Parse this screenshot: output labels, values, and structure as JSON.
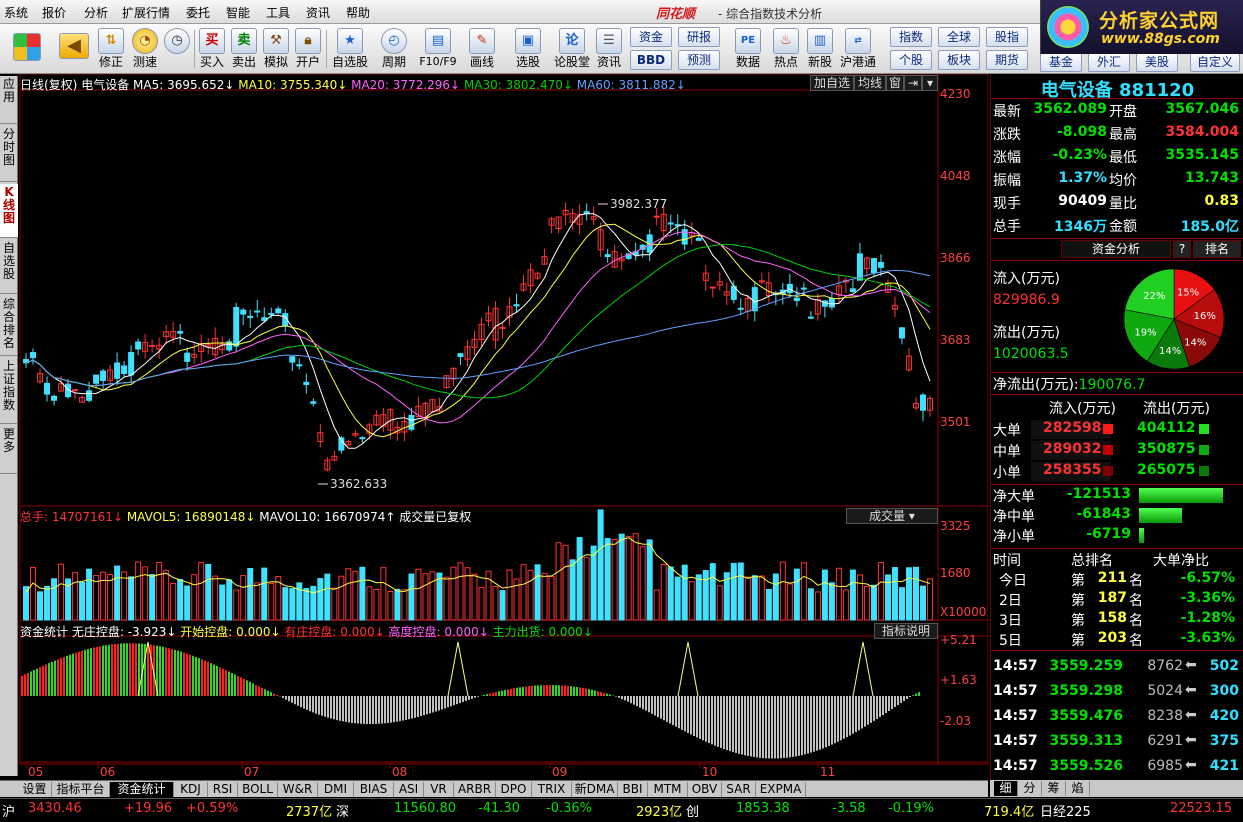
{
  "menu": [
    "系统",
    "报价",
    "分析",
    "扩展行情",
    "委托",
    "智能",
    "工具",
    "资讯",
    "帮助"
  ],
  "brand": "同花顺",
  "app_title": "- 综合指数技术分析",
  "logo": {
    "cn": "分析家公式网",
    "url": "www.88gs.com"
  },
  "toolbar": {
    "buttons": [
      "修正",
      "测速",
      "买入",
      "卖出",
      "模拟",
      "开户",
      "自选股",
      "周期",
      "F10/F9",
      "画线",
      "选股",
      "论股堂",
      "资讯",
      "数据",
      "热点",
      "新股",
      "沪港通"
    ],
    "icon_glyphs": [
      "买",
      "卖",
      "论"
    ],
    "small": [
      "资金",
      "BBD",
      "研报",
      "预测",
      "指数",
      "全球",
      "股指",
      "个股",
      "板块",
      "期货",
      "基金",
      "外汇",
      "美股",
      "自定义"
    ]
  },
  "left_tabs": [
    "应用",
    "分时图",
    "K线图",
    "自选股",
    "综合排名",
    "上证指数",
    "更多"
  ],
  "kline_header": {
    "label": "日线(复权)",
    "name": "电气设备",
    "ma5": "MA5: 3695.652",
    "ma10": "MA10: 3755.340",
    "ma20": "MA20: 3772.296",
    "ma30": "MA30: 3802.470",
    "ma60": "MA60: 3811.882",
    "btn_add": "加自选",
    "btn_ma": "均线",
    "btn_win": "窗"
  },
  "price_axis": [
    "4230",
    "4048",
    "3866",
    "3683",
    "3501"
  ],
  "annotations": {
    "high": "3982.377",
    "low": "3362.633"
  },
  "volume_header": {
    "total": "总手: 14707161",
    "mavol5": "MAVOL5: 16890148",
    "mavol10": "MAVOL10: 16670974",
    "note": "成交量已复权",
    "selector": "成交量"
  },
  "volume_axis": [
    "3325",
    "1680",
    "X10000"
  ],
  "fund_header": {
    "title": "资金统计",
    "a": "无庄控盘: -3.923",
    "b": "开始控盘: 0.000",
    "c": "有庄控盘: 0.000",
    "d": "高度控盘: 0.000",
    "e": "主力出货: 0.000",
    "btn": "指标说明"
  },
  "fund_axis": [
    "+5.21",
    "+1.63",
    "-2.03"
  ],
  "date_axis": [
    "05",
    "06",
    "07",
    "08",
    "09",
    "10",
    "11"
  ],
  "bottom_tabs": [
    "设置",
    "指标平台",
    "资金统计",
    "KDJ",
    "RSI",
    "BOLL",
    "W&R",
    "DMI",
    "BIAS",
    "ASI",
    "VR",
    "ARBR",
    "DPO",
    "TRIX",
    "新DMA",
    "BBI",
    "MTM",
    "OBV",
    "SAR",
    "EXPMA"
  ],
  "right_panel": {
    "title": "电气设备 881120",
    "quote": [
      {
        "l1": "最新",
        "v1": "3562.089",
        "l2": "开盘",
        "v2": "3567.046",
        "c1": "grn",
        "c2": "grn"
      },
      {
        "l1": "涨跌",
        "v1": "-8.098",
        "l2": "最高",
        "v2": "3584.004",
        "c1": "grn",
        "c2": "red"
      },
      {
        "l1": "涨幅",
        "v1": "-0.23%",
        "l2": "最低",
        "v2": "3535.145",
        "c1": "grn",
        "c2": "grn"
      },
      {
        "l1": "振幅",
        "v1": "1.37%",
        "l2": "均价",
        "v2": "13.743",
        "c1": "cyn",
        "c2": "grn"
      },
      {
        "l1": "现手",
        "v1": "90409",
        "l2": "量比",
        "v2": "0.83",
        "c1": "wht",
        "c2": "yel"
      },
      {
        "l1": "总手",
        "v1": "1346万",
        "l2": "金额",
        "v2": "185.0亿",
        "c1": "cyn",
        "c2": "cyn"
      }
    ],
    "fund_tab": "资金分析",
    "help_btn": "?",
    "rank_btn": "排名",
    "inflow_label": "流入(万元)",
    "inflow_value": "829986.9",
    "outflow_label": "流出(万元)",
    "outflow_value": "1020063.5",
    "net_label": "净流出(万元):",
    "net_value": "190076.7",
    "pie": [
      {
        "label": "15%",
        "value": 15,
        "color": "#e81010"
      },
      {
        "label": "16%",
        "value": 16,
        "color": "#b80d0d"
      },
      {
        "label": "14%",
        "value": 14,
        "color": "#8a0a0a"
      },
      {
        "label": "14%",
        "value": 14,
        "color": "#0a7a0a"
      },
      {
        "label": "19%",
        "value": 19,
        "color": "#10a810"
      },
      {
        "label": "22%",
        "value": 22,
        "color": "#20d020"
      }
    ],
    "flow_head": {
      "in": "流入(万元)",
      "out": "流出(万元)"
    },
    "flows": [
      {
        "label": "大单",
        "in": "282598",
        "out": "404112"
      },
      {
        "label": "中单",
        "in": "289032",
        "out": "350875"
      },
      {
        "label": "小单",
        "in": "258355",
        "out": "265075"
      }
    ],
    "nets": [
      {
        "label": "净大单",
        "value": "-121513",
        "bar": 1.0
      },
      {
        "label": "净中单",
        "value": "-61843",
        "bar": 0.51
      },
      {
        "label": "净小单",
        "value": "-6719",
        "bar": 0.06
      }
    ],
    "rank_head": {
      "a": "时间",
      "b": "总排名",
      "c": "大单净比"
    },
    "ranks": [
      {
        "t": "今日",
        "pre": "第",
        "n": "211",
        "suf": "名",
        "r": "-6.57%"
      },
      {
        "t": "2日",
        "pre": "第",
        "n": "187",
        "suf": "名",
        "r": "-3.36%"
      },
      {
        "t": "3日",
        "pre": "第",
        "n": "158",
        "suf": "名",
        "r": "-1.28%"
      },
      {
        "t": "5日",
        "pre": "第",
        "n": "203",
        "suf": "名",
        "r": "-3.63%"
      }
    ],
    "ticks": [
      {
        "t": "14:57",
        "p": "3559.259",
        "v": "8762",
        "n": "502"
      },
      {
        "t": "14:57",
        "p": "3559.298",
        "v": "5024",
        "n": "300"
      },
      {
        "t": "14:57",
        "p": "3559.476",
        "v": "8238",
        "n": "420"
      },
      {
        "t": "14:57",
        "p": "3559.313",
        "v": "6291",
        "n": "375"
      },
      {
        "t": "14:57",
        "p": "3559.526",
        "v": "6985",
        "n": "421"
      }
    ],
    "bottom_tabs": [
      "细",
      "分",
      "筹",
      "焰"
    ]
  },
  "statusbar": {
    "a": "沪",
    "b": "3430.46",
    "c": "+19.96",
    "d": "+0.59%",
    "e": "2737亿",
    "f": "深",
    "g": "11560.80",
    "h": "-41.30",
    "i": "-0.36%",
    "j": "2923亿",
    "k": "创",
    "l": "1853.38",
    "m": "-3.58",
    "n": "-0.19%",
    "o": "719.4亿",
    "p": "日经225",
    "q": "22523.15"
  },
  "colors": {
    "up": "#ff3232",
    "down": "#40e0ff",
    "ma5": "#ffffff",
    "ma10": "#ffff40",
    "ma20": "#ff60ff",
    "ma30": "#00d000",
    "ma60": "#60a0ff",
    "grid": "#8b0000"
  }
}
